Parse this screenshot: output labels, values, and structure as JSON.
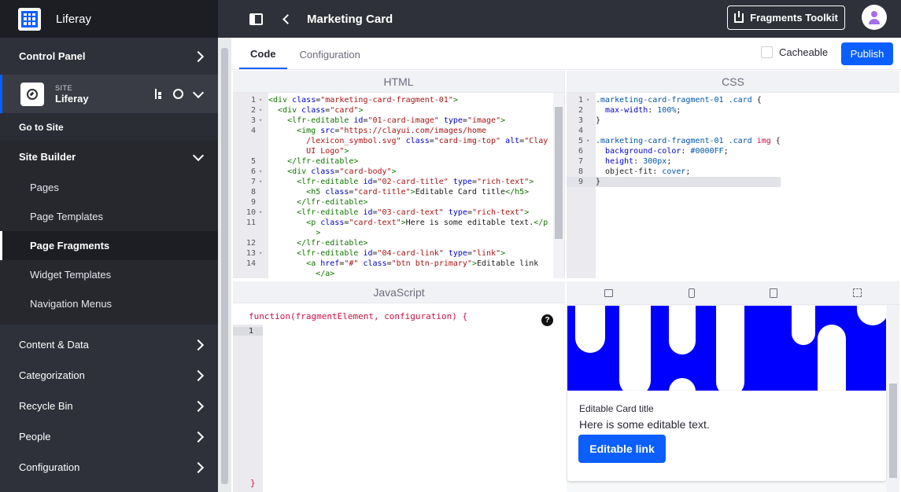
{
  "sidebar": {
    "brand": "Liferay",
    "control_panel": "Control Panel",
    "site_kicker": "SITE",
    "site_name": "Liferay",
    "go_to_site": "Go to Site",
    "site_builder": "Site Builder",
    "builder_items": [
      "Pages",
      "Page Templates",
      "Page Fragments",
      "Widget Templates",
      "Navigation Menus"
    ],
    "active_item": "Page Fragments",
    "lower_items": [
      "Content & Data",
      "Categorization",
      "Recycle Bin",
      "People",
      "Configuration"
    ]
  },
  "topbar": {
    "title": "Marketing Card",
    "toolkit_label": "Fragments Toolkit"
  },
  "editor": {
    "tabs": [
      "Code",
      "Configuration"
    ],
    "active_tab": "Code",
    "cacheable_label": "Cacheable",
    "publish_label": "Publish",
    "html_title": "HTML",
    "css_title": "CSS",
    "js_title": "JavaScript",
    "js_signature": "function(fragmentElement, configuration) {",
    "js_close": "}",
    "js_line": "1",
    "help": "?"
  },
  "preview": {
    "card_title": "Editable Card title",
    "card_text": "Here is some editable text.",
    "card_link": "Editable link",
    "image_color": "#0000FF"
  },
  "colors": {
    "accent": "#0b5fff",
    "sidebar": "#2e3139"
  }
}
